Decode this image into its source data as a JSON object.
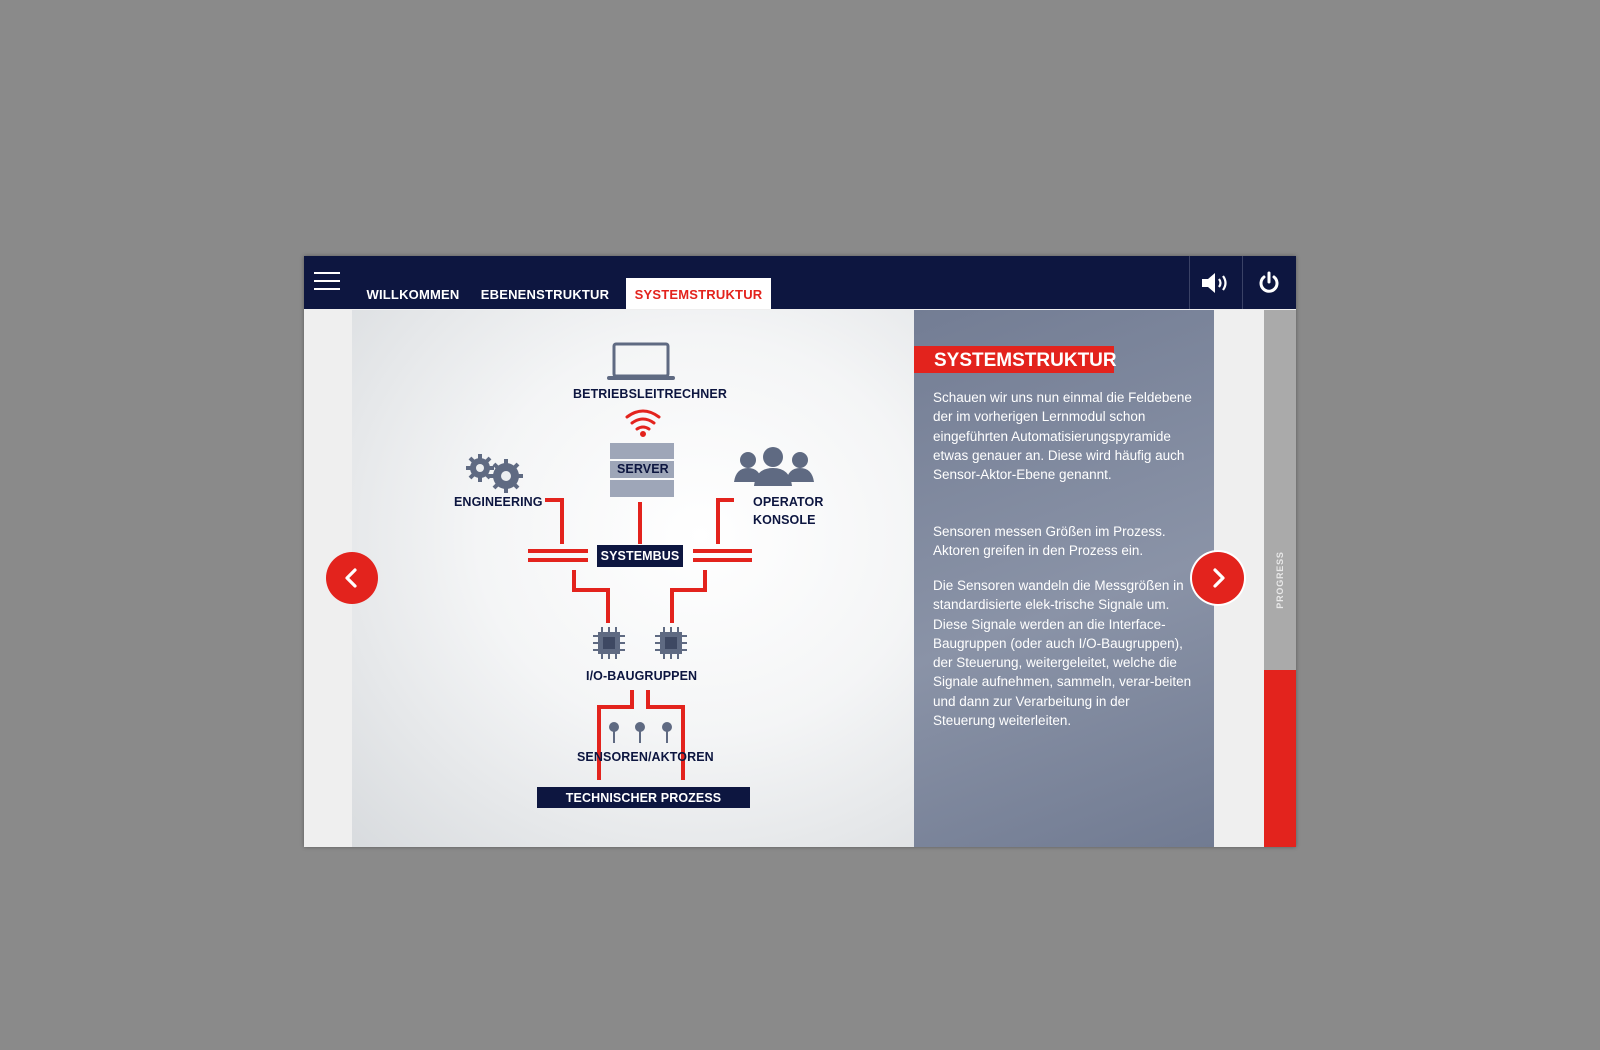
{
  "header": {
    "tabs": [
      {
        "label": "WILLKOMMEN",
        "active": false
      },
      {
        "label": "EBENENSTRUKTUR",
        "active": false
      },
      {
        "label": "SYSTEMSTRUKTUR",
        "active": true
      }
    ],
    "icons": {
      "menu": "hamburger-icon",
      "sound": "speaker-icon",
      "power": "power-icon"
    }
  },
  "diagram": {
    "computer_label": "BETRIEBSLEITRECHNER",
    "server_label": "SERVER",
    "engineering_label": "ENGINEERING",
    "operator_label_line1": "OPERATOR",
    "operator_label_line2": "KONSOLE",
    "bus_label": "SYSTEMBUS",
    "io_label": "I/O-BAUGRUPPEN",
    "sensors_label": "SENSOREN/AKTOREN",
    "process_label": "TECHNISCHER PROZESS"
  },
  "panel": {
    "title": "SYSTEMSTRUKTUR",
    "paragraphs": [
      "Schauen wir uns nun einmal die Feldebene der im vorherigen Lernmodul schon eingeführten Automatisierungspyramide etwas genauer an. Diese wird häufig auch Sensor-Aktor-Ebene genannt.",
      "Sensoren messen Größen im Prozess. Aktoren greifen in den Prozess ein.",
      "Die Sensoren wandeln die Messgrößen in standardisierte elek-trische Signale um. Diese Signale werden an die Interface-Baugruppen (oder auch I/O-Baugruppen), der Steuerung, weitergeleitet, welche die Signale aufnehmen, sammeln, verar-beiten und dann zur Verarbeitung in der Steuerung weiterleiten."
    ]
  },
  "progress": {
    "label": "PROGRESS",
    "fraction": 0.33
  },
  "colors": {
    "accent": "#e3231d",
    "navy": "#0d1640",
    "panel": "#7e889c"
  }
}
